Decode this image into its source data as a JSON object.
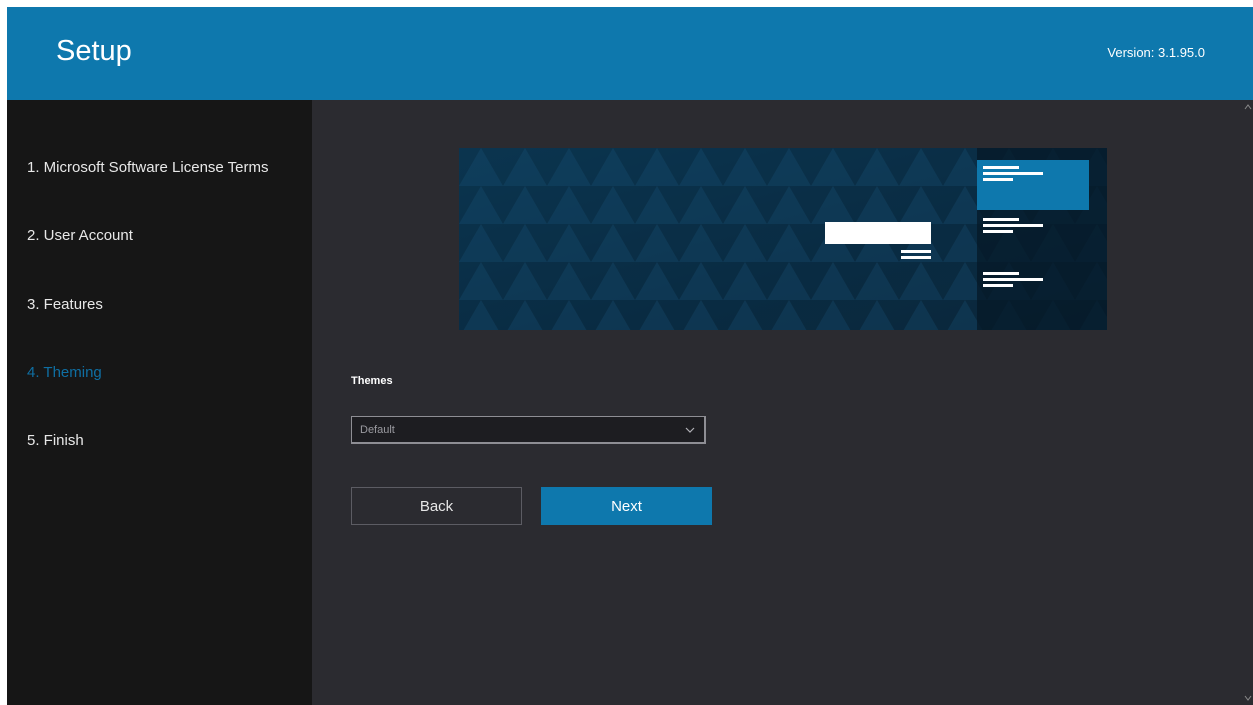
{
  "app": {
    "title": "Setup",
    "version": "Version: 3.1.95.0"
  },
  "steps": [
    {
      "label": "1. Microsoft Software License Terms",
      "active": false
    },
    {
      "label": "2. User Account",
      "active": false
    },
    {
      "label": "3. Features",
      "active": false
    },
    {
      "label": "4. Theming",
      "active": true
    },
    {
      "label": "5. Finish",
      "active": false
    }
  ],
  "theming": {
    "label": "Themes",
    "selected": "Default"
  },
  "buttons": {
    "back": "Back",
    "next": "Next"
  },
  "icons": {
    "dropdown": "chevron-down-icon",
    "scroll_up": "chevron-up-icon",
    "scroll_down": "chevron-down-icon"
  },
  "colors": {
    "accent": "#0e78ad",
    "active_step": "#0f6fa3",
    "sidebar": "#161616",
    "main": "#2b2b30"
  }
}
